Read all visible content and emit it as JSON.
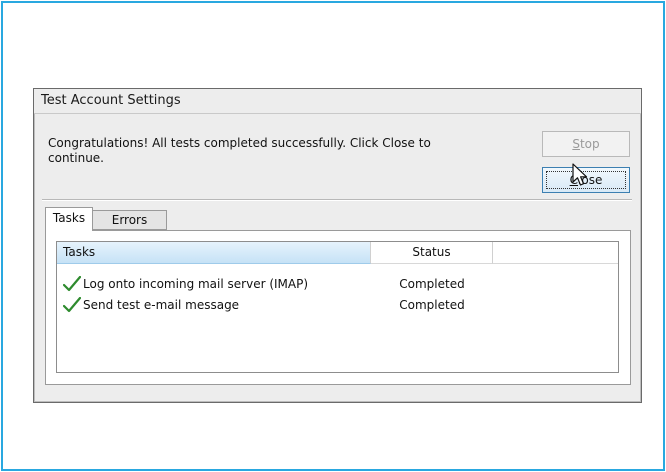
{
  "dialog": {
    "title": "Test Account Settings",
    "message": "Congratulations! All tests completed successfully. Click Close to continue.",
    "stop_button": {
      "pre": "",
      "accel": "S",
      "post": "top"
    },
    "close_button": {
      "pre": "",
      "accel": "C",
      "post": "lose"
    }
  },
  "tabs": [
    {
      "label": "Tasks",
      "active": true
    },
    {
      "label": "Errors",
      "active": false
    }
  ],
  "table": {
    "columns": [
      "Tasks",
      "Status",
      ""
    ],
    "rows": [
      {
        "task": "Log onto incoming mail server (IMAP)",
        "status": "Completed",
        "icon": "check-icon"
      },
      {
        "task": "Send test e-mail message",
        "status": "Completed",
        "icon": "check-icon"
      }
    ]
  },
  "colors": {
    "accent_border": "#29a8e0",
    "check": "#2e8b2e"
  }
}
